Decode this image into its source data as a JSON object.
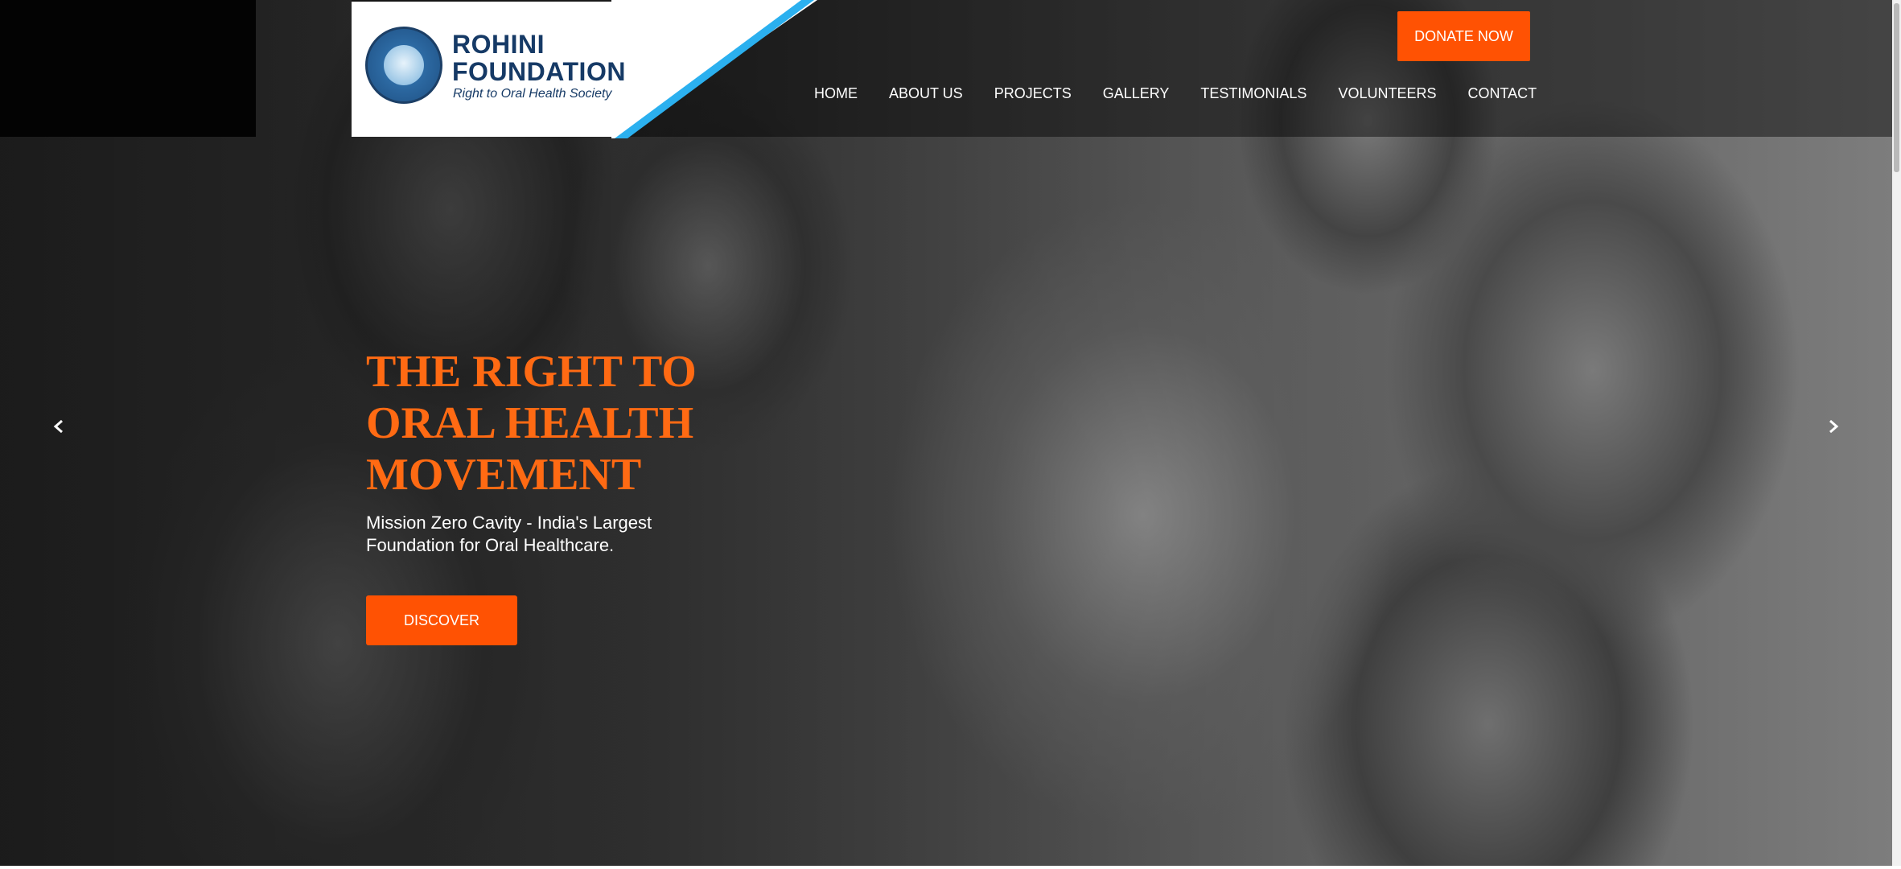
{
  "brand": {
    "name": "ROHINI FOUNDATION",
    "name_line1": "ROHINI",
    "name_line2": "FOUNDATION",
    "tagline": "Right to Oral Health Society",
    "colors": {
      "navy": "#163a66",
      "accent_orange": "#ff5203",
      "heading_orange": "#ff6a13",
      "stripe_blue": "#2bb0ef"
    }
  },
  "header": {
    "donate_label": "DONATE NOW",
    "nav": [
      {
        "label": "HOME"
      },
      {
        "label": "ABOUT US"
      },
      {
        "label": "PROJECTS"
      },
      {
        "label": "GALLERY"
      },
      {
        "label": "TESTIMONIALS"
      },
      {
        "label": "VOLUNTEERS"
      },
      {
        "label": "CONTACT"
      }
    ]
  },
  "hero": {
    "heading": "THE RIGHT TO ORAL HEALTH MOVEMENT",
    "subheading": "Mission Zero Cavity - India's Largest Foundation for Oral Healthcare.",
    "cta_label": "DISCOVER",
    "prev_icon": "chevron-left-icon",
    "next_icon": "chevron-right-icon"
  }
}
